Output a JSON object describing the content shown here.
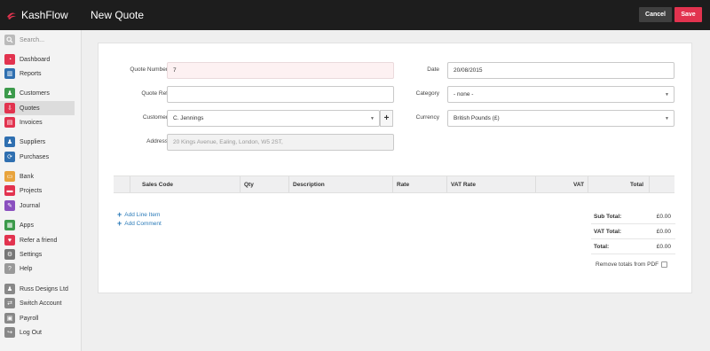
{
  "app": {
    "name": "KashFlow",
    "page_title": "New Quote"
  },
  "toolbar": {
    "cancel_label": "Cancel",
    "save_label": "Save"
  },
  "sidebar": {
    "search_placeholder": "Search...",
    "items": [
      {
        "label": "Dashboard",
        "icon": "dashboard-icon",
        "color": "#e2334f"
      },
      {
        "label": "Reports",
        "icon": "reports-icon",
        "color": "#2f6fb0"
      },
      {
        "label": "Customers",
        "icon": "customers-icon",
        "color": "#3c9a4b"
      },
      {
        "label": "Quotes",
        "icon": "quotes-icon",
        "color": "#e2334f"
      },
      {
        "label": "Invoices",
        "icon": "invoices-icon",
        "color": "#e2334f"
      },
      {
        "label": "Suppliers",
        "icon": "suppliers-icon",
        "color": "#2f6fb0"
      },
      {
        "label": "Purchases",
        "icon": "purchases-icon",
        "color": "#2f6fb0"
      },
      {
        "label": "Bank",
        "icon": "bank-icon",
        "color": "#e8a33c"
      },
      {
        "label": "Projects",
        "icon": "projects-icon",
        "color": "#e2334f"
      },
      {
        "label": "Journal",
        "icon": "journal-icon",
        "color": "#8a4fbf"
      },
      {
        "label": "Apps",
        "icon": "apps-icon",
        "color": "#3c9a4b"
      },
      {
        "label": "Refer a friend",
        "icon": "heart-icon",
        "color": "#e2334f"
      },
      {
        "label": "Settings",
        "icon": "gear-icon",
        "color": "#777777"
      },
      {
        "label": "Help",
        "icon": "help-icon",
        "color": "#999999"
      },
      {
        "label": "Russ Designs Ltd",
        "icon": "company-icon",
        "color": "#888888"
      },
      {
        "label": "Switch Account",
        "icon": "switch-icon",
        "color": "#888888"
      },
      {
        "label": "Payroll",
        "icon": "payroll-icon",
        "color": "#888888"
      },
      {
        "label": "Log Out",
        "icon": "logout-icon",
        "color": "#888888"
      }
    ]
  },
  "form": {
    "quote_number_label": "Quote Number",
    "quote_number_value": "7",
    "quote_ref_label": "Quote Ref",
    "quote_ref_value": "",
    "customer_label": "Customer",
    "customer_value": "C. Jennings",
    "address_label": "Address",
    "address_value": "20 Kings Avenue, Ealing, London,  W5 2ST,",
    "date_label": "Date",
    "date_value": "20/08/2015",
    "category_label": "Category",
    "category_value": "- none -",
    "currency_label": "Currency",
    "currency_value": "British Pounds (£)"
  },
  "table": {
    "columns": [
      "Sales Code",
      "Qty",
      "Description",
      "Rate",
      "VAT Rate",
      "VAT",
      "Total"
    ]
  },
  "actions": {
    "add_line_item": "Add Line Item",
    "add_comment": "Add Comment"
  },
  "totals": {
    "sub_total_label": "Sub Total:",
    "sub_total_value": "£0.00",
    "vat_total_label": "VAT Total:",
    "vat_total_value": "£0.00",
    "total_label": "Total:",
    "total_value": "£0.00",
    "remove_totals_label": "Remove totals from PDF"
  }
}
